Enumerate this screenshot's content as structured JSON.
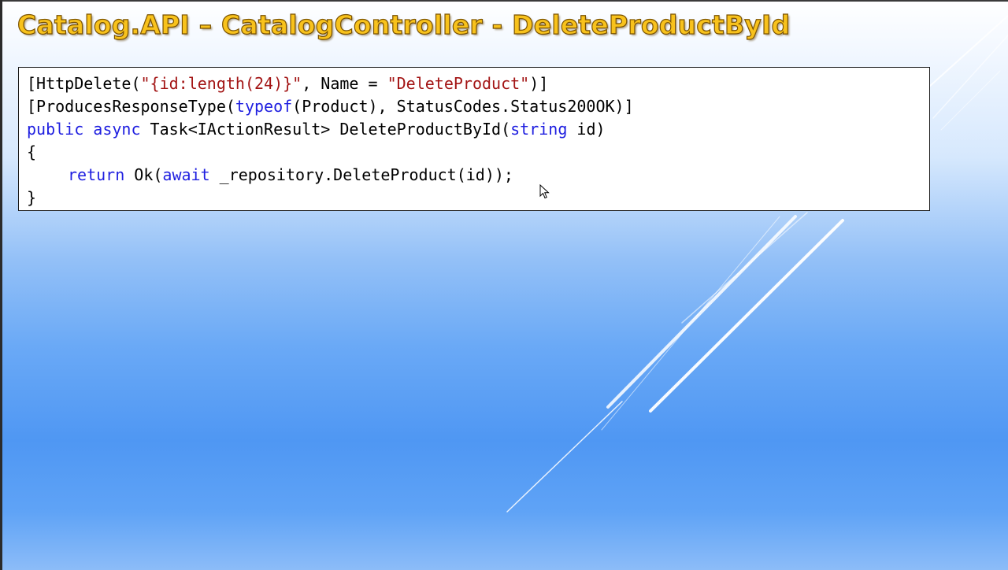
{
  "slide": {
    "title": "Catalog.API – CatalogController - DeleteProductById",
    "colors": {
      "title": "#f8c21c",
      "title_outline": "#7a5200",
      "keyword": "#1f1fe0",
      "string": "#a31515",
      "background_top": "#ffffff",
      "background_bottom": "#4f97f3"
    }
  },
  "code": {
    "line1": {
      "t1": "[HttpDelete(",
      "s1": "\"{id:length(24)}\"",
      "t2": ", Name = ",
      "s2": "\"DeleteProduct\"",
      "t3": ")]"
    },
    "line2": {
      "t1": "[ProducesResponseType(",
      "k1": "typeof",
      "t2": "(Product), StatusCodes.Status200OK)]"
    },
    "line3": {
      "k1": "public",
      "k2": "async",
      "t1": " Task<IActionResult> DeleteProductById(",
      "k3": "string",
      "t2": " id)"
    },
    "line4": {
      "t1": "{"
    },
    "line5": {
      "k1": "return",
      "t1": " Ok(",
      "k2": "await",
      "t2": " _repository.DeleteProduct(id));"
    },
    "line6": {
      "t1": "}"
    }
  },
  "cursor_icon": "mouse-pointer-icon"
}
